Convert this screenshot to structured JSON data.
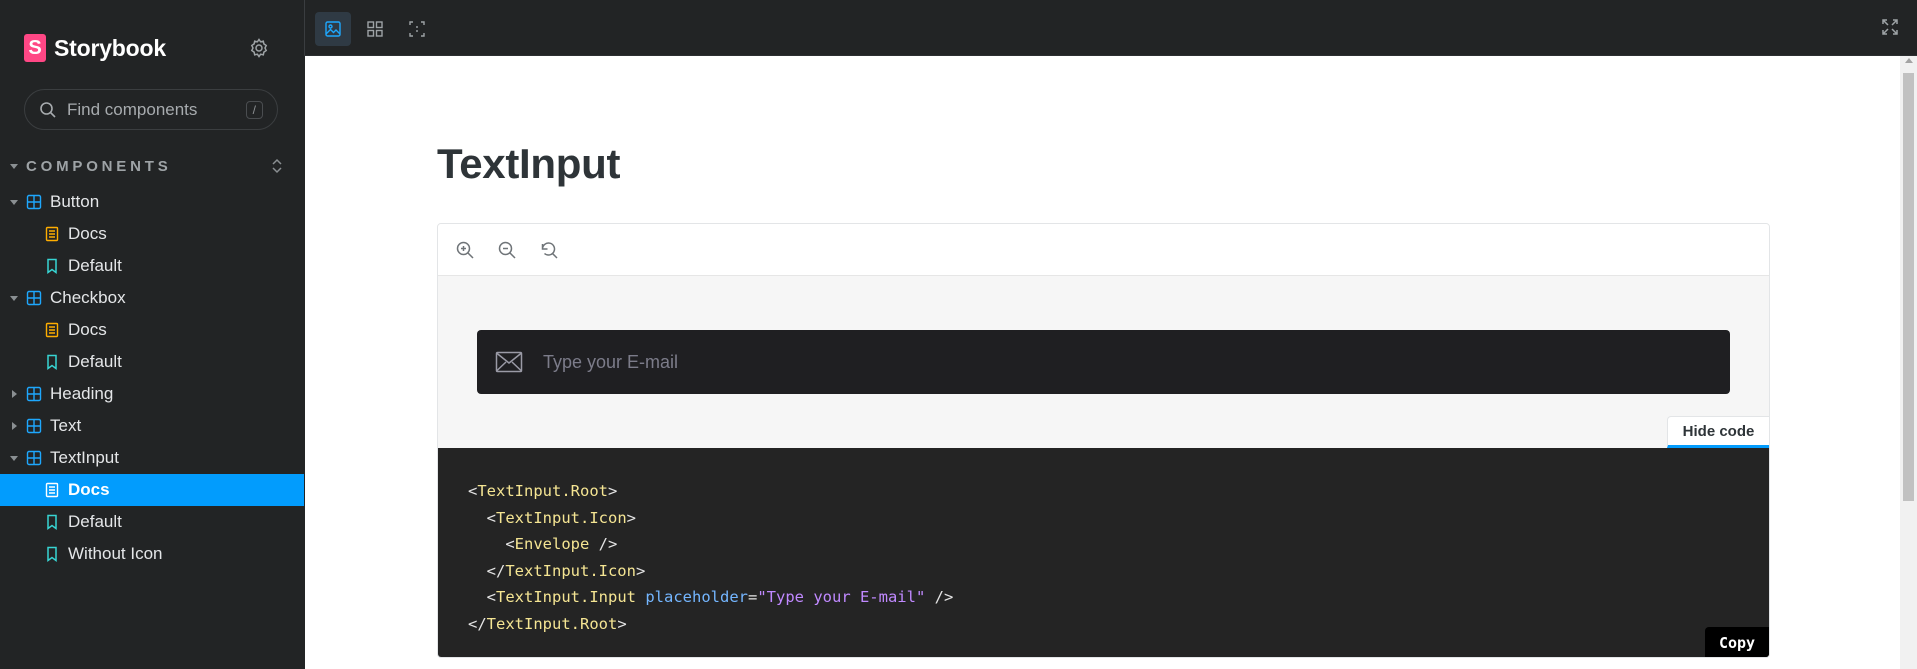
{
  "sidebar": {
    "brand": {
      "logo_letter": "S",
      "name": "Storybook",
      "logo_color": "#ff4785"
    },
    "search": {
      "placeholder": "Find components",
      "shortcut": "/"
    },
    "section_title": "COMPONENTS",
    "items": [
      {
        "label": "Button",
        "type": "component",
        "expanded": true
      },
      {
        "label": "Docs",
        "type": "docs"
      },
      {
        "label": "Default",
        "type": "story"
      },
      {
        "label": "Checkbox",
        "type": "component",
        "expanded": true
      },
      {
        "label": "Docs",
        "type": "docs"
      },
      {
        "label": "Default",
        "type": "story"
      },
      {
        "label": "Heading",
        "type": "component",
        "expanded": false
      },
      {
        "label": "Text",
        "type": "component",
        "expanded": false
      },
      {
        "label": "TextInput",
        "type": "component",
        "expanded": true
      },
      {
        "label": "Docs",
        "type": "docs",
        "selected": true
      },
      {
        "label": "Default",
        "type": "story"
      },
      {
        "label": "Without Icon",
        "type": "story"
      }
    ]
  },
  "colors": {
    "accent": "#029cfd",
    "component_icon": "#1ea7fd",
    "docs_icon": "#ffae00",
    "story_icon": "#37d5d3"
  },
  "toolbar": {
    "tools": [
      "image-icon",
      "grid-icon",
      "outline-icon"
    ],
    "active_tool": "image-icon",
    "fullscreen": "expand-icon"
  },
  "doc": {
    "title": "TextInput",
    "preview": {
      "zoom_controls": [
        "zoom-in-icon",
        "zoom-out-icon",
        "zoom-reset-icon"
      ],
      "input_placeholder": "Type your E-mail",
      "hide_code_label": "Hide code",
      "copy_label": "Copy"
    },
    "code": {
      "line1_tag": "TextInput.Root",
      "line2_tag": "TextInput.Icon",
      "line3_tag": "Envelope",
      "line4_tag": "TextInput.Icon",
      "line5_tag": "TextInput.Input",
      "line5_attr": "placeholder",
      "line5_value": "\"Type your E-mail\"",
      "line6_tag": "TextInput.Root"
    }
  }
}
